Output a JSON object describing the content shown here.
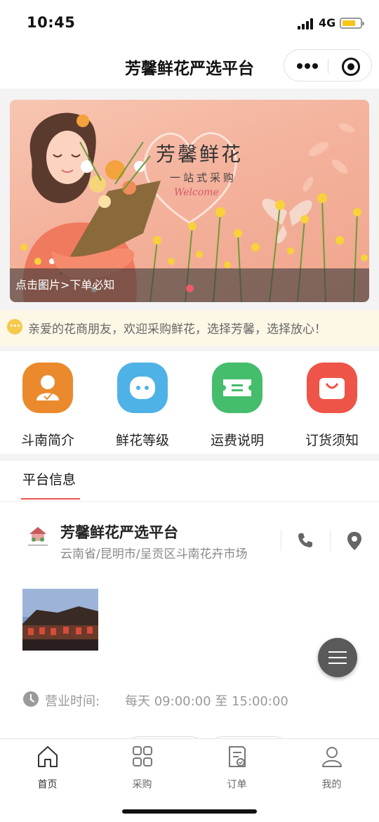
{
  "status_bar": {
    "time": "10:45",
    "network": "4G",
    "battery_level": 0.75
  },
  "nav": {
    "title": "芳馨鲜花严选平台",
    "more_icon": "more-dots-icon",
    "close_icon": "target-icon"
  },
  "banner": {
    "title": "芳馨鲜花",
    "subtitle": "一站式采购",
    "welcome": "Welcome",
    "caption": "点击图片>下单必知"
  },
  "notice": {
    "text": "亲爱的花商朋友，欢迎采购鲜花，选择芳馨，选择放心！"
  },
  "quick_menu": [
    {
      "label": "斗南简介",
      "color": "#ea8a2c"
    },
    {
      "label": "鲜花等级",
      "color": "#4fb2e6"
    },
    {
      "label": "运费说明",
      "color": "#45bd6c"
    },
    {
      "label": "订货须知",
      "color": "#ee5448"
    }
  ],
  "section": {
    "tab": "平台信息"
  },
  "shop": {
    "name": "芳馨鲜花严选平台",
    "address": "云南省/昆明市/呈贡区斗南花卉市场",
    "hours_label": "营业时间:",
    "hours_value": "每天 09:00:00 至 15:00:00"
  },
  "tabbar": [
    {
      "label": "首页",
      "icon": "home-icon"
    },
    {
      "label": "采购",
      "icon": "grid-icon"
    },
    {
      "label": "订单",
      "icon": "order-icon"
    },
    {
      "label": "我的",
      "icon": "user-icon"
    }
  ],
  "colors": {
    "accent": "#e8534f",
    "notice_bg": "#fdf7e6"
  }
}
